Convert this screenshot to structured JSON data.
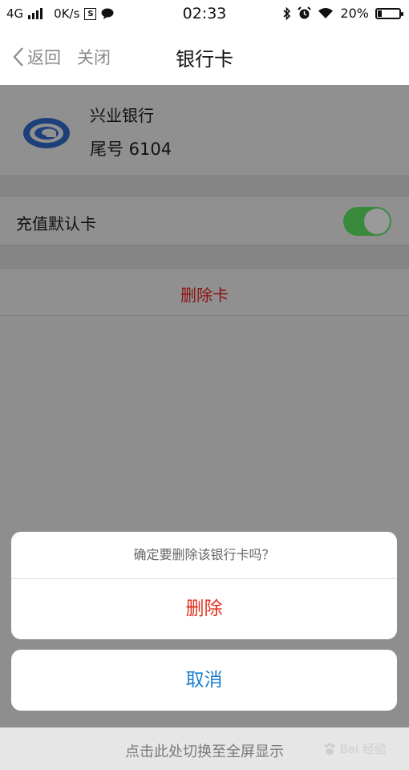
{
  "status_bar": {
    "network": "4G",
    "speed": "0K/s",
    "time": "02:33",
    "battery_percent": "20%",
    "battery_level": 0.2,
    "icons": [
      "signal-icon",
      "s-app-icon",
      "message-icon",
      "bluetooth-icon",
      "alarm-icon",
      "wifi-icon",
      "battery-icon"
    ]
  },
  "nav": {
    "back_label": "返回",
    "close_label": "关闭",
    "title": "银行卡"
  },
  "card": {
    "bank_name": "兴业银行",
    "tail_number": "尾号 6104",
    "logo_color": "#1d3f7a"
  },
  "settings": {
    "default_card_label": "充值默认卡",
    "default_card_enabled": true,
    "delete_card_label": "删除卡"
  },
  "action_sheet": {
    "message": "确定要删除该银行卡吗？",
    "delete_label": "删除",
    "cancel_label": "取消",
    "delete_color": "#e0301e",
    "cancel_color": "#1a7fd0"
  },
  "bottom_bar": {
    "text": "点击此处切换至全屏显示",
    "watermark_text": "Bai 经验"
  }
}
